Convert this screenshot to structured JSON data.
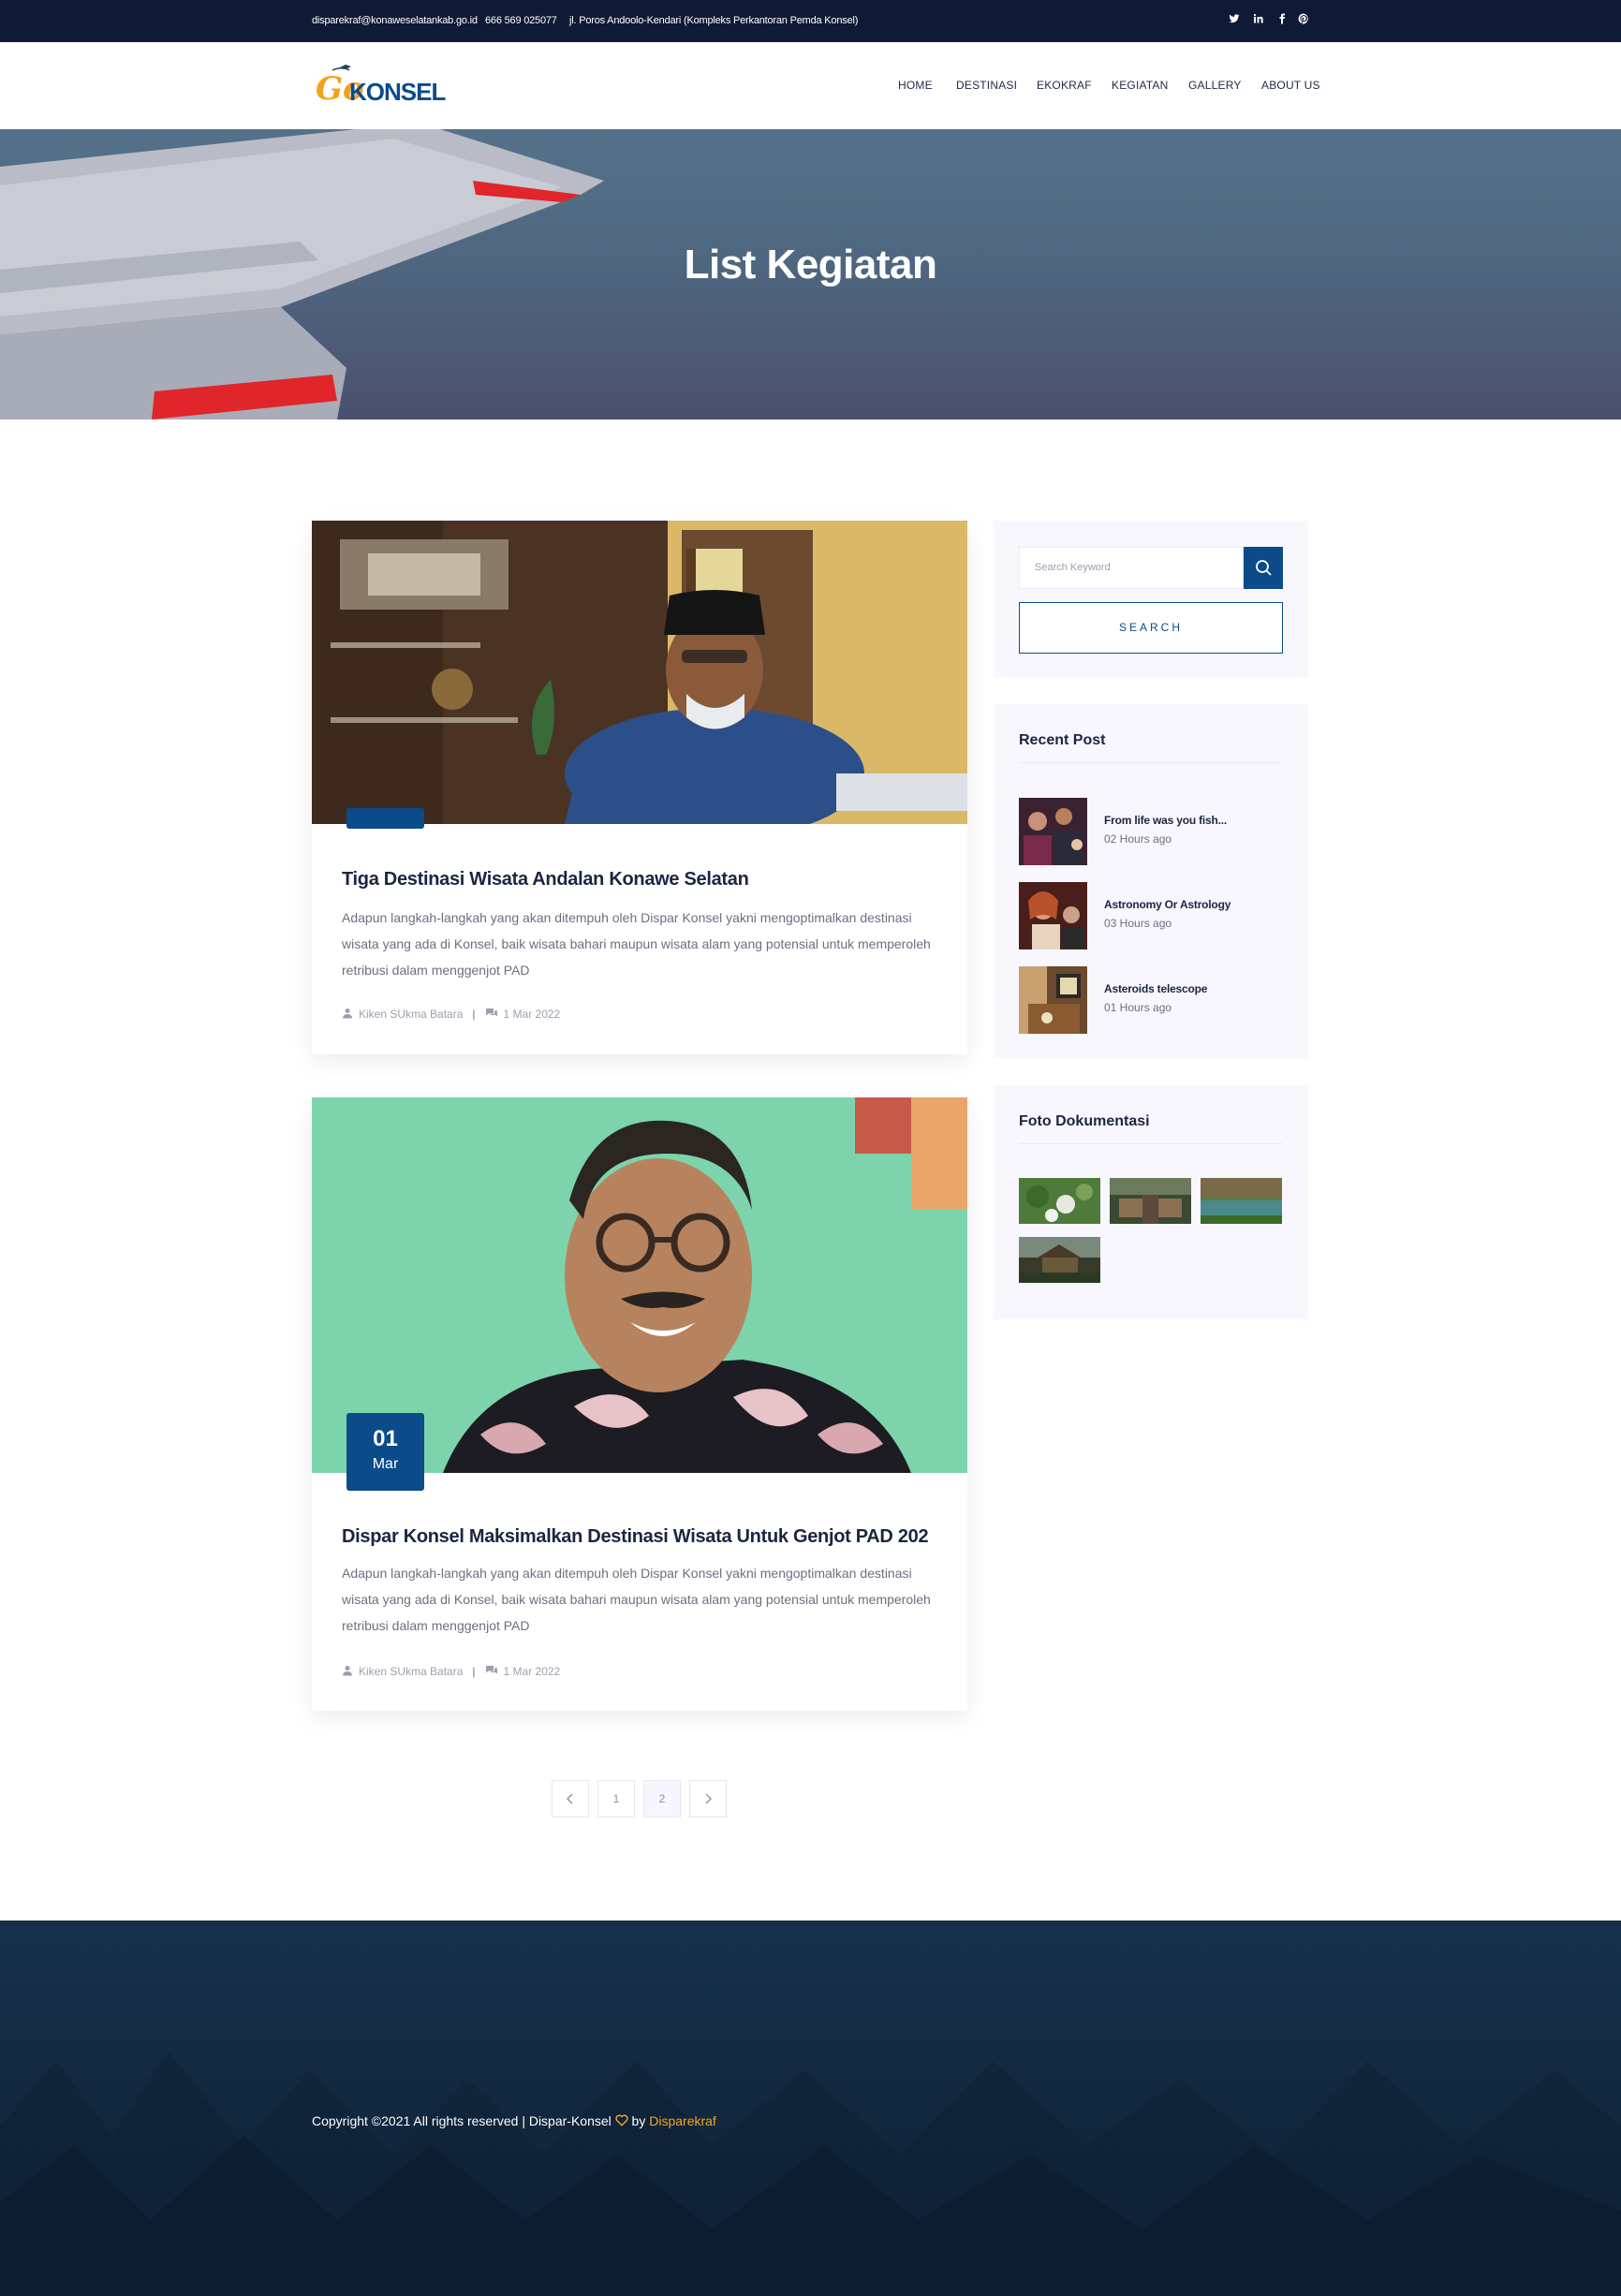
{
  "topbar": {
    "email": "disparekraf@konaweselatankab.go.id",
    "phone": "666 569 025077",
    "address": "jl. Poros Andoolo-Kendari (Kompleks Perkantoran Pemda Konsel)",
    "social": [
      "twitter-icon",
      "linkedin-icon",
      "facebook-icon",
      "pinterest-icon"
    ]
  },
  "logo": {
    "text_go": "Go",
    "text_konsel": "KONSEL"
  },
  "nav": [
    "HOME",
    "DESTINASI",
    "EKOKRAF",
    "KEGIATAN",
    "GALLERY",
    "ABOUT US"
  ],
  "hero": {
    "title": "List Kegiatan"
  },
  "posts": [
    {
      "day": "",
      "month": "",
      "title": "Tiga Destinasi Wisata Andalan Konawe Selatan",
      "excerpt": "Adapun langkah-langkah yang akan ditempuh oleh Dispar Konsel yakni mengoptimalkan destinasi wisata yang ada di Konsel, baik wisata bahari maupun wisata alam yang potensial untuk memperoleh retribusi dalam menggenjot PAD",
      "author": "Kiken SUkma Batara",
      "date": "1 Mar 2022"
    },
    {
      "day": "01",
      "month": "Mar",
      "title": "Dispar Konsel Maksimalkan Destinasi Wisata Untuk Genjot PAD 202",
      "excerpt": "Adapun langkah-langkah yang akan ditempuh oleh Dispar Konsel yakni mengoptimalkan destinasi wisata yang ada di Konsel, baik wisata bahari maupun wisata alam yang potensial untuk memperoleh retribusi dalam menggenjot PAD",
      "author": "Kiken SUkma Batara",
      "date": "1 Mar 2022"
    }
  ],
  "pagination": {
    "pages": [
      "1",
      "2"
    ],
    "current": "2"
  },
  "sidebar": {
    "search": {
      "placeholder": "Search Keyword",
      "button": "SEARCH"
    },
    "recent": {
      "title": "Recent Post",
      "items": [
        {
          "title": "From life was you fish...",
          "time": "02 Hours ago"
        },
        {
          "title": "Astronomy Or Astrology",
          "time": "03 Hours ago"
        },
        {
          "title": "Asteroids telescope",
          "time": "01 Hours ago"
        }
      ]
    },
    "foto": {
      "title": "Foto Dokumentasi"
    }
  },
  "footer": {
    "copyright": "Copyright ©2021 All rights reserved | Dispar-Konsel",
    "by": "by",
    "brand": "Disparekraf"
  },
  "colors": {
    "primary": "#0b4b8a",
    "topbar": "#0f1a36",
    "accent": "#f5a623",
    "footer": "#14293f"
  }
}
